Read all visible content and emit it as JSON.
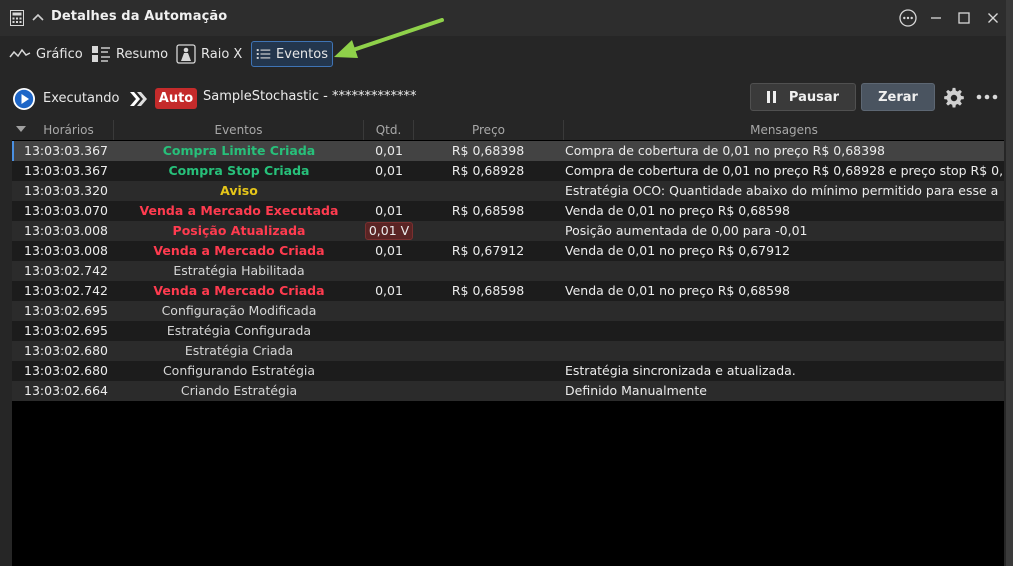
{
  "window": {
    "title": "Detalhes da Automação"
  },
  "tabs": [
    {
      "label": "Gráfico",
      "icon": "line-chart-icon"
    },
    {
      "label": "Resumo",
      "icon": "summary-icon"
    },
    {
      "label": "Raio X",
      "icon": "xray-icon"
    },
    {
      "label": "Eventos",
      "icon": "list-icon",
      "active": true
    }
  ],
  "status": {
    "state_label": "Executando",
    "badge": "Auto",
    "strategy_name": "SampleStochastic - *************",
    "pause_label": "Pausar",
    "reset_label": "Zerar"
  },
  "grid": {
    "columns": [
      "Horários",
      "Eventos",
      "Qtd.",
      "Preço",
      "Mensagens"
    ],
    "rows": [
      {
        "time": "13:03:03.367",
        "event": "Compra Limite Criada",
        "event_color": "#27c07a",
        "qty": "0,01",
        "price": "R$ 0,68398",
        "message": "Compra de cobertura de 0,01 no preço R$ 0,68398"
      },
      {
        "time": "13:03:03.367",
        "event": "Compra Stop Criada",
        "event_color": "#27c07a",
        "qty": "0,01",
        "price": "R$ 0,68928",
        "message": "Compra de cobertura de 0,01 no preço R$ 0,68928 e preço stop R$ 0,"
      },
      {
        "time": "13:03:03.320",
        "event": "Aviso",
        "event_color": "#e6c619",
        "qty": "",
        "price": "",
        "message": "Estratégia OCO: Quantidade abaixo do mínimo permitido para esse a"
      },
      {
        "time": "13:03:03.070",
        "event": "Venda a Mercado Executada",
        "event_color": "#ff3b4f",
        "qty": "0,01",
        "price": "R$ 0,68598",
        "message": "Venda de 0,01 no preço R$ 0,68598"
      },
      {
        "time": "13:03:03.008",
        "event": "Posição Atualizada",
        "event_color": "#ff3b4f",
        "qty": "0,01 V",
        "price": "",
        "message": "Posição aumentada de 0,00 para -0,01"
      },
      {
        "time": "13:03:03.008",
        "event": "Venda a Mercado Criada",
        "event_color": "#ff3b4f",
        "qty": "0,01",
        "price": "R$ 0,67912",
        "message": "Venda de 0,01 no preço R$ 0,67912"
      },
      {
        "time": "13:03:02.742",
        "event": "Estratégia Habilitada",
        "event_color": "#d6d6d6",
        "qty": "",
        "price": "",
        "message": ""
      },
      {
        "time": "13:03:02.742",
        "event": "Venda a Mercado Criada",
        "event_color": "#ff3b4f",
        "qty": "0,01",
        "price": "R$ 0,68598",
        "message": "Venda de 0,01 no preço R$ 0,68598"
      },
      {
        "time": "13:03:02.695",
        "event": "Configuração Modificada",
        "event_color": "#d6d6d6",
        "qty": "",
        "price": "",
        "message": ""
      },
      {
        "time": "13:03:02.695",
        "event": "Estratégia Configurada",
        "event_color": "#d6d6d6",
        "qty": "",
        "price": "",
        "message": ""
      },
      {
        "time": "13:03:02.680",
        "event": "Estratégia Criada",
        "event_color": "#d6d6d6",
        "qty": "",
        "price": "",
        "message": ""
      },
      {
        "time": "13:03:02.680",
        "event": "Configurando Estratégia",
        "event_color": "#d6d6d6",
        "qty": "",
        "price": "",
        "message": "Estratégia sincronizada e atualizada."
      },
      {
        "time": "13:03:02.664",
        "event": "Criando Estratégia",
        "event_color": "#d6d6d6",
        "qty": "",
        "price": "",
        "message": "Definido Manualmente"
      }
    ]
  },
  "colors": {
    "accent": "#3f74b5",
    "badge_red": "#c42b2b",
    "annotation_arrow": "#8fd14a"
  }
}
